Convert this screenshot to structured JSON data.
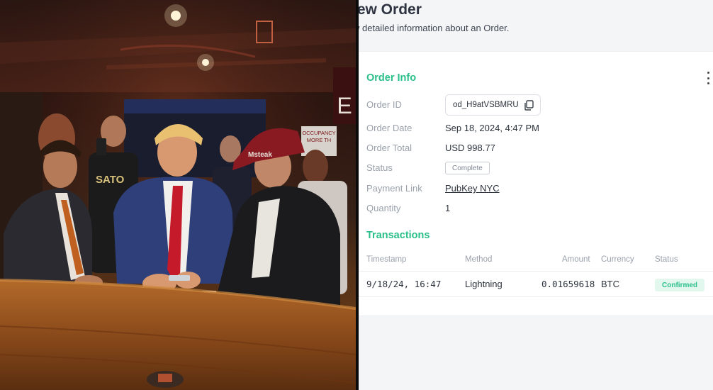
{
  "header": {
    "title": "iew Order",
    "subtitle": "w detailed information about an Order."
  },
  "order_info": {
    "section_title": "Order Info",
    "fields": {
      "order_id_label": "Order ID",
      "order_id_value": "od_H9atVSBMRU",
      "order_date_label": "Order Date",
      "order_date_value": "Sep 18, 2024, 4:47 PM",
      "order_total_label": "Order Total",
      "order_total_value": "USD 998.77",
      "status_label": "Status",
      "status_value": "Complete",
      "payment_link_label": "Payment Link",
      "payment_link_value": "PubKey NYC",
      "quantity_label": "Quantity",
      "quantity_value": "1"
    }
  },
  "transactions": {
    "section_title": "Transactions",
    "columns": [
      "Timestamp",
      "Method",
      "Amount",
      "Currency",
      "Status"
    ],
    "rows": [
      {
        "timestamp": "9/18/24, 16:47",
        "method": "Lightning",
        "amount": "0.01659618",
        "currency": "BTC",
        "status": "Confirmed"
      }
    ]
  },
  "photo": {
    "cap_text": "Msteak",
    "sign_text": "OCCUPANCY\nMORE TH",
    "exit_letter": "E",
    "shirt_text": "SATO"
  },
  "colors": {
    "accent": "#2bbf8a",
    "panel_bg": "#f4f5f7",
    "card_bg": "#ffffff",
    "text": "#2d333d",
    "muted": "#9aa1ab"
  }
}
